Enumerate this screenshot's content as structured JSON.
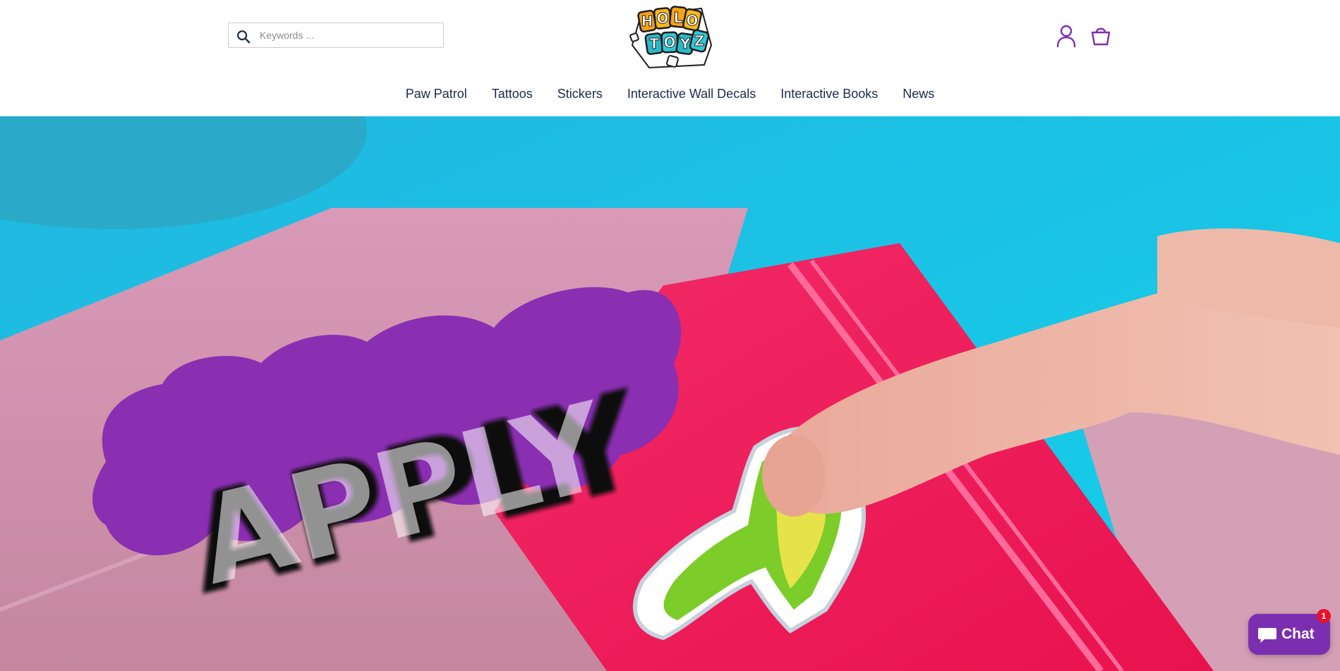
{
  "search": {
    "placeholder": "Keywords ..."
  },
  "logo": {
    "text_top": "HOLO",
    "text_bottom": "TOYZ"
  },
  "header_icons": {
    "account": "user-icon",
    "cart": "shopping-bag-icon"
  },
  "nav": {
    "items": [
      {
        "label": "Paw Patrol"
      },
      {
        "label": "Tattoos"
      },
      {
        "label": "Stickers"
      },
      {
        "label": "Interactive Wall Decals"
      },
      {
        "label": "Interactive Books"
      },
      {
        "label": "News"
      }
    ]
  },
  "hero": {
    "overlay_text": "APPLY"
  },
  "chat": {
    "label": "Chat",
    "badge_count": "1"
  },
  "colors": {
    "nav_text": "#1d2a4d",
    "accent_purple": "#7b2fb0",
    "badge_red": "#e8112d",
    "hero_cyan": "#1fc4e6",
    "notebook_pink": "#f0195a"
  }
}
